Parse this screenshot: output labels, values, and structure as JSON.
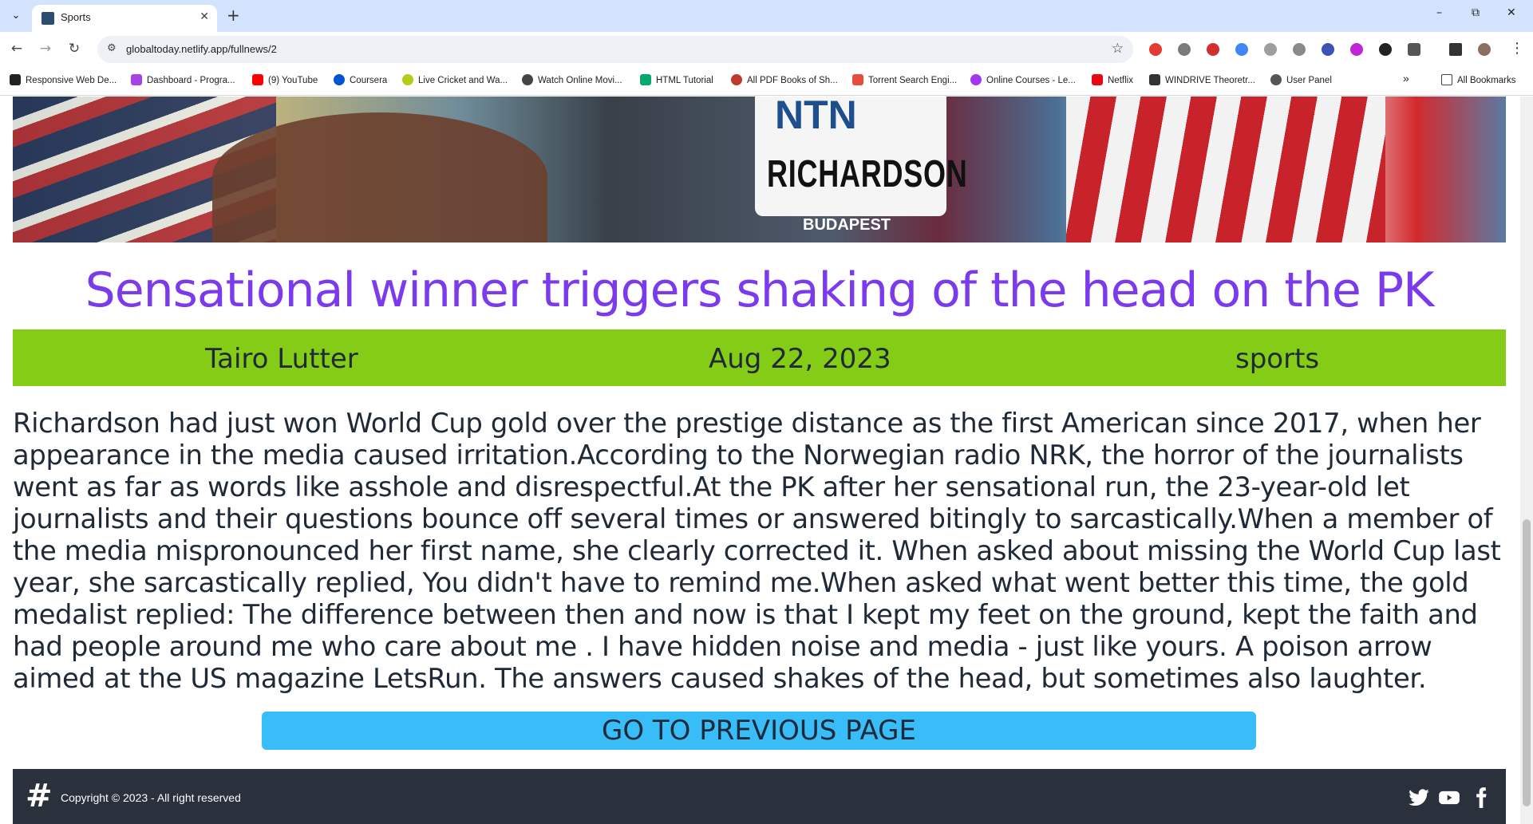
{
  "browser": {
    "tab_title": "Sports",
    "url": "globaltoday.netlify.app/fullnews/2",
    "window_controls": [
      "–",
      "⧉",
      "✕"
    ],
    "bookmarks": [
      {
        "label": "Responsive Web De...",
        "color": "#222222"
      },
      {
        "label": "Dashboard - Progra...",
        "color": "#a742e6"
      },
      {
        "label": "(9) YouTube",
        "color": "#ff0000"
      },
      {
        "label": "Coursera",
        "color": "#0056d2"
      },
      {
        "label": "Live Cricket and Wa...",
        "color": "#b5cc18"
      },
      {
        "label": "Watch Online Movi...",
        "color": "#444444"
      },
      {
        "label": "HTML Tutorial",
        "color": "#04aa6d"
      },
      {
        "label": "All PDF Books of Sh...",
        "color": "#c0392b"
      },
      {
        "label": "Torrent Search Engi...",
        "color": "#e74c3c"
      },
      {
        "label": "Online Courses - Le...",
        "color": "#a435f0"
      },
      {
        "label": "Netflix",
        "color": "#e50914"
      },
      {
        "label": "WINDRIVE Theoretr...",
        "color": "#333333"
      },
      {
        "label": "User Panel",
        "color": "#555555"
      }
    ],
    "all_bookmarks": "All Bookmarks"
  },
  "hero": {
    "bib_top": "NTN",
    "bib_name": "RICHARDSON",
    "bib_sub": "BUDAPEST"
  },
  "article": {
    "headline": "Sensational winner triggers shaking of the head on the PK",
    "author": "Tairo Lutter",
    "date": "Aug 22, 2023",
    "category": "sports",
    "body": "Richardson had just won World Cup gold over the prestige distance as the first American since 2017, when her appearance in the media caused irritation.According to the Norwegian radio NRK, the horror of the journalists went as far as words like asshole and disrespectful.At the PK after her sensational run, the 23-year-old let journalists and their questions bounce off several times or answered bitingly to sarcastically.When a member of the media mispronounced her first name, she clearly corrected it. When asked about missing the World Cup last year, she sarcastically replied, You didn't have to remind me.When asked what went better this time, the gold medalist replied: The difference between then and now is that I kept my feet on the ground, kept the faith and had people around me who care about me . I have hidden noise and media - just like yours. A poison arrow aimed at the US magazine LetsRun. The answers caused shakes of the head, but sometimes also laughter.",
    "prev_button": "GO TO PREVIOUS PAGE"
  },
  "footer": {
    "copyright": "Copyright © 2023 - All right reserved",
    "social": [
      "twitter-icon",
      "youtube-icon",
      "facebook-icon"
    ]
  },
  "colors": {
    "headline": "#7c3aed",
    "meta_bar": "#84cc16",
    "button": "#38bdf8",
    "footer": "#2a303c"
  }
}
